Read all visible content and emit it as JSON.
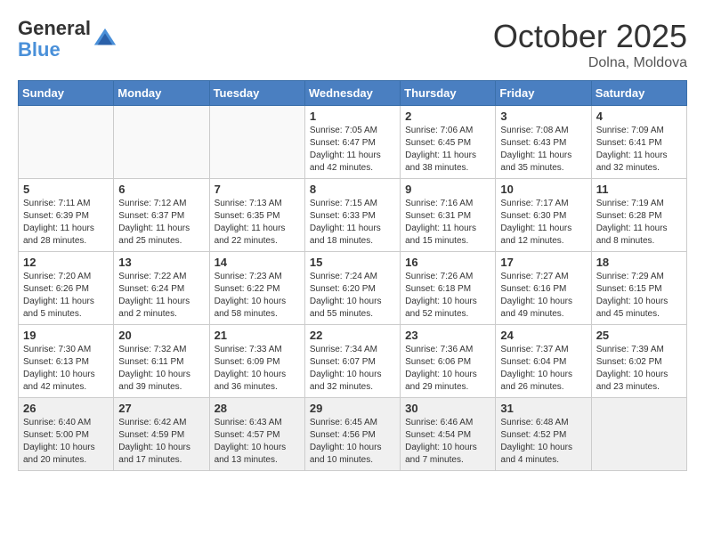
{
  "header": {
    "logo_line1": "General",
    "logo_line2": "Blue",
    "month": "October 2025",
    "location": "Dolna, Moldova"
  },
  "weekdays": [
    "Sunday",
    "Monday",
    "Tuesday",
    "Wednesday",
    "Thursday",
    "Friday",
    "Saturday"
  ],
  "weeks": [
    [
      {
        "day": "",
        "info": ""
      },
      {
        "day": "",
        "info": ""
      },
      {
        "day": "",
        "info": ""
      },
      {
        "day": "1",
        "info": "Sunrise: 7:05 AM\nSunset: 6:47 PM\nDaylight: 11 hours\nand 42 minutes."
      },
      {
        "day": "2",
        "info": "Sunrise: 7:06 AM\nSunset: 6:45 PM\nDaylight: 11 hours\nand 38 minutes."
      },
      {
        "day": "3",
        "info": "Sunrise: 7:08 AM\nSunset: 6:43 PM\nDaylight: 11 hours\nand 35 minutes."
      },
      {
        "day": "4",
        "info": "Sunrise: 7:09 AM\nSunset: 6:41 PM\nDaylight: 11 hours\nand 32 minutes."
      }
    ],
    [
      {
        "day": "5",
        "info": "Sunrise: 7:11 AM\nSunset: 6:39 PM\nDaylight: 11 hours\nand 28 minutes."
      },
      {
        "day": "6",
        "info": "Sunrise: 7:12 AM\nSunset: 6:37 PM\nDaylight: 11 hours\nand 25 minutes."
      },
      {
        "day": "7",
        "info": "Sunrise: 7:13 AM\nSunset: 6:35 PM\nDaylight: 11 hours\nand 22 minutes."
      },
      {
        "day": "8",
        "info": "Sunrise: 7:15 AM\nSunset: 6:33 PM\nDaylight: 11 hours\nand 18 minutes."
      },
      {
        "day": "9",
        "info": "Sunrise: 7:16 AM\nSunset: 6:31 PM\nDaylight: 11 hours\nand 15 minutes."
      },
      {
        "day": "10",
        "info": "Sunrise: 7:17 AM\nSunset: 6:30 PM\nDaylight: 11 hours\nand 12 minutes."
      },
      {
        "day": "11",
        "info": "Sunrise: 7:19 AM\nSunset: 6:28 PM\nDaylight: 11 hours\nand 8 minutes."
      }
    ],
    [
      {
        "day": "12",
        "info": "Sunrise: 7:20 AM\nSunset: 6:26 PM\nDaylight: 11 hours\nand 5 minutes."
      },
      {
        "day": "13",
        "info": "Sunrise: 7:22 AM\nSunset: 6:24 PM\nDaylight: 11 hours\nand 2 minutes."
      },
      {
        "day": "14",
        "info": "Sunrise: 7:23 AM\nSunset: 6:22 PM\nDaylight: 10 hours\nand 58 minutes."
      },
      {
        "day": "15",
        "info": "Sunrise: 7:24 AM\nSunset: 6:20 PM\nDaylight: 10 hours\nand 55 minutes."
      },
      {
        "day": "16",
        "info": "Sunrise: 7:26 AM\nSunset: 6:18 PM\nDaylight: 10 hours\nand 52 minutes."
      },
      {
        "day": "17",
        "info": "Sunrise: 7:27 AM\nSunset: 6:16 PM\nDaylight: 10 hours\nand 49 minutes."
      },
      {
        "day": "18",
        "info": "Sunrise: 7:29 AM\nSunset: 6:15 PM\nDaylight: 10 hours\nand 45 minutes."
      }
    ],
    [
      {
        "day": "19",
        "info": "Sunrise: 7:30 AM\nSunset: 6:13 PM\nDaylight: 10 hours\nand 42 minutes."
      },
      {
        "day": "20",
        "info": "Sunrise: 7:32 AM\nSunset: 6:11 PM\nDaylight: 10 hours\nand 39 minutes."
      },
      {
        "day": "21",
        "info": "Sunrise: 7:33 AM\nSunset: 6:09 PM\nDaylight: 10 hours\nand 36 minutes."
      },
      {
        "day": "22",
        "info": "Sunrise: 7:34 AM\nSunset: 6:07 PM\nDaylight: 10 hours\nand 32 minutes."
      },
      {
        "day": "23",
        "info": "Sunrise: 7:36 AM\nSunset: 6:06 PM\nDaylight: 10 hours\nand 29 minutes."
      },
      {
        "day": "24",
        "info": "Sunrise: 7:37 AM\nSunset: 6:04 PM\nDaylight: 10 hours\nand 26 minutes."
      },
      {
        "day": "25",
        "info": "Sunrise: 7:39 AM\nSunset: 6:02 PM\nDaylight: 10 hours\nand 23 minutes."
      }
    ],
    [
      {
        "day": "26",
        "info": "Sunrise: 6:40 AM\nSunset: 5:00 PM\nDaylight: 10 hours\nand 20 minutes."
      },
      {
        "day": "27",
        "info": "Sunrise: 6:42 AM\nSunset: 4:59 PM\nDaylight: 10 hours\nand 17 minutes."
      },
      {
        "day": "28",
        "info": "Sunrise: 6:43 AM\nSunset: 4:57 PM\nDaylight: 10 hours\nand 13 minutes."
      },
      {
        "day": "29",
        "info": "Sunrise: 6:45 AM\nSunset: 4:56 PM\nDaylight: 10 hours\nand 10 minutes."
      },
      {
        "day": "30",
        "info": "Sunrise: 6:46 AM\nSunset: 4:54 PM\nDaylight: 10 hours\nand 7 minutes."
      },
      {
        "day": "31",
        "info": "Sunrise: 6:48 AM\nSunset: 4:52 PM\nDaylight: 10 hours\nand 4 minutes."
      },
      {
        "day": "",
        "info": ""
      }
    ]
  ]
}
